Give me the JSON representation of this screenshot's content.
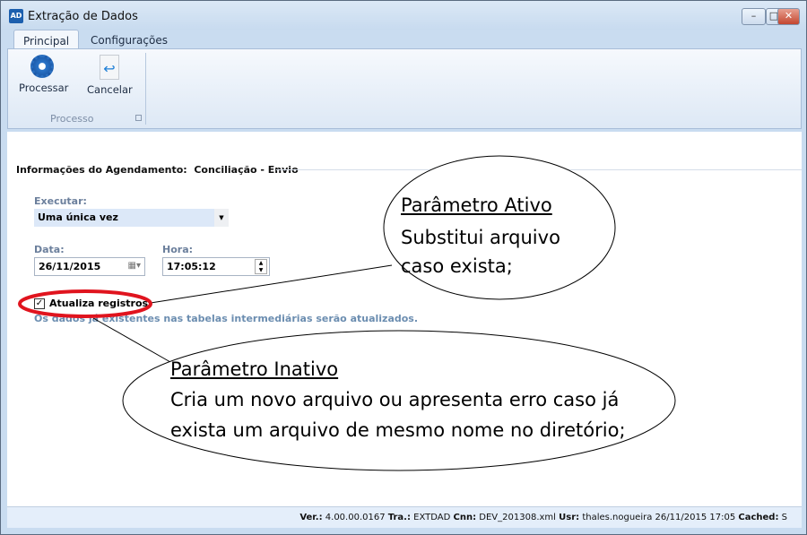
{
  "window": {
    "title": "Extração de Dados",
    "app_icon": "AD",
    "controls": [
      "minimize",
      "maximize",
      "close"
    ]
  },
  "tabs": [
    {
      "label": "Principal",
      "active": true
    },
    {
      "label": "Configurações",
      "active": false
    }
  ],
  "ribbon": {
    "buttons": [
      {
        "label": "Processar",
        "icon": "gear-icon"
      },
      {
        "label": "Cancelar",
        "icon": "undo-document-icon"
      }
    ],
    "group_label": "Processo"
  },
  "form": {
    "section_title": "Informações do Agendamento:  Conciliação - Envio",
    "executar_label": "Executar:",
    "executar_value": "Uma única vez",
    "data_label": "Data:",
    "data_value": "26/11/2015",
    "hora_label": "Hora:",
    "hora_value": "17:05:12",
    "checkbox_label": "Atualiza registros",
    "checkbox_checked": true,
    "hint": "Os dados já existentes nas tabelas intermediárias serão atualizados."
  },
  "callouts": {
    "active": {
      "title": "Parâmetro Ativo",
      "line1": "Substitui arquivo",
      "line2": "caso exista;"
    },
    "inactive": {
      "title": "Parâmetro Inativo",
      "line1": "Cria um novo arquivo ou apresenta erro caso já",
      "line2": "exista um arquivo de mesmo nome no diretório;"
    },
    "highlight_color": "#e0141e"
  },
  "status": {
    "ver_label": "Ver.:",
    "ver": "4.00.00.0167",
    "tra_label": "Tra.:",
    "tra": "EXTDAD",
    "cnn_label": "Cnn:",
    "cnn": "DEV_201308.xml",
    "usr_label": "Usr:",
    "usr": "thales.nogueira",
    "datetime": "26/11/2015 17:05",
    "cached_label": "Cached:",
    "cached": "S"
  }
}
